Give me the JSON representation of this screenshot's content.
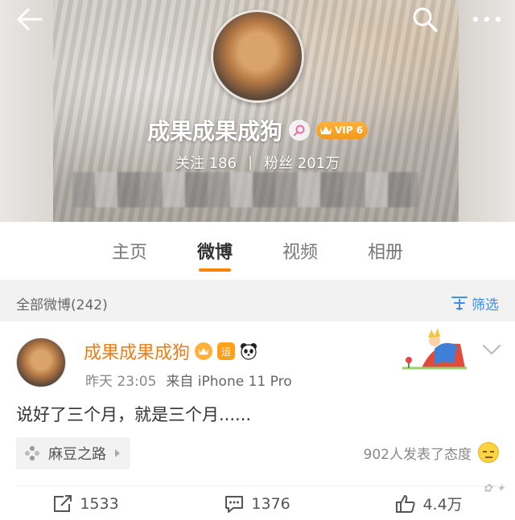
{
  "cover": {
    "name": "成果成果成狗",
    "vip_label": "VIP 6",
    "follow_label": "关注",
    "follow_count": "186",
    "separator": "|",
    "fans_label": "粉丝",
    "fans_count": "201万"
  },
  "tabs": [
    {
      "label": "主页",
      "active": false
    },
    {
      "label": "微博",
      "active": true
    },
    {
      "label": "视频",
      "active": false
    },
    {
      "label": "相册",
      "active": false
    }
  ],
  "filter": {
    "label": "全部微博(242)",
    "button_label": "筛选"
  },
  "post": {
    "author": "成果成果成狗",
    "luck_badge": "运",
    "time": "昨天 23:05",
    "source": "来自 iPhone 11 Pro",
    "text": "说好了三个月，就是三个月......",
    "topic": "麻豆之路",
    "reaction_summary": "902人发表了态度",
    "repost_count": "1533",
    "comment_count": "1376",
    "like_count": "4.4万"
  },
  "icons": {
    "back": "arrow-left-icon",
    "search": "search-icon",
    "more": "more-dots-icon",
    "filter": "filter-icon",
    "topic": "pinwheel-icon",
    "repost": "share-icon",
    "comment": "comment-icon",
    "like": "thumbs-up-icon"
  },
  "colors": {
    "accent_orange": "#ff8200",
    "author_orange": "#f07c15",
    "link_blue": "#3f8ee8"
  }
}
